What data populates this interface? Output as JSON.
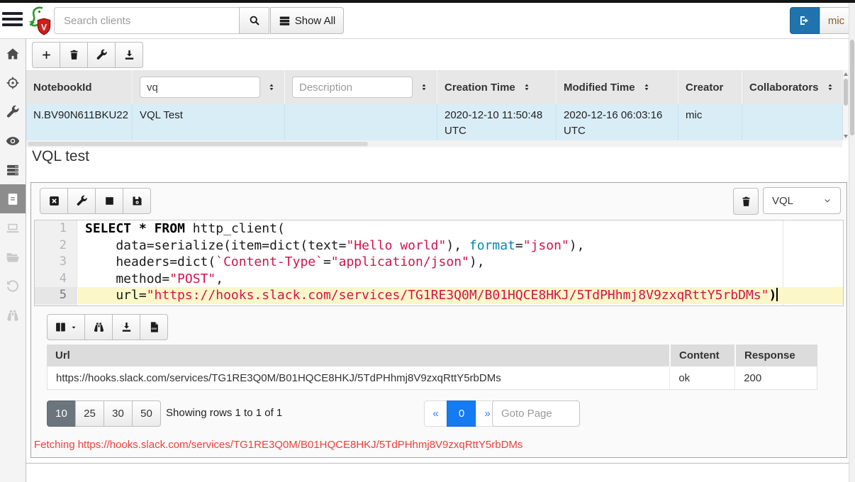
{
  "topbar": {
    "search_placeholder": "Search clients",
    "search_value": "",
    "show_all_label": "Show All",
    "user_label": "mic"
  },
  "colors": {
    "logout_blue": "#2074ae",
    "pager_active_blue": "#147bf0",
    "selected_row_blue": "#d9edf7",
    "active_line_yellow": "#fbf7c8",
    "code_string_red": "#d1154b",
    "code_builtin_blue": "#0086b3",
    "status_error_red": "#ee3f3b",
    "active_pagesize_gray": "#6c757d"
  },
  "sidebar": {
    "items": [
      {
        "icon": "home-icon",
        "state": "enabled"
      },
      {
        "icon": "crosshair-icon",
        "state": "enabled"
      },
      {
        "icon": "wrench-icon",
        "state": "enabled"
      },
      {
        "icon": "eye-icon",
        "state": "enabled"
      },
      {
        "icon": "server-icon",
        "state": "enabled"
      },
      {
        "icon": "notebook-icon",
        "state": "active"
      },
      {
        "icon": "laptop-icon",
        "state": "disabled"
      },
      {
        "icon": "folder-icon",
        "state": "disabled"
      },
      {
        "icon": "history-icon",
        "state": "disabled"
      },
      {
        "icon": "binoculars-icon",
        "state": "disabled"
      }
    ]
  },
  "notebooks": {
    "toolbar": [
      {
        "icon": "plus-icon"
      },
      {
        "icon": "trash-icon"
      },
      {
        "icon": "wrench-icon"
      },
      {
        "icon": "download-icon"
      }
    ],
    "table": {
      "columns": [
        {
          "label": "NotebookId"
        },
        {
          "value": "vq",
          "placeholder": ""
        },
        {
          "value": "",
          "placeholder": "Description"
        },
        {
          "label": "Creation Time"
        },
        {
          "label": "Modified Time"
        },
        {
          "label": "Creator"
        },
        {
          "label": "Collaborators"
        }
      ],
      "row": {
        "notebook_id": "N.BV90N611BKU22",
        "name": "VQL Test",
        "description": "",
        "creation_time": "2020-12-10 11:50:48 UTC",
        "modified_time": "2020-12-16 06:03:16 UTC",
        "creator": "mic",
        "collaborators": ""
      }
    }
  },
  "notebook": {
    "title": "VQL test",
    "cell_toolbar": [
      {
        "icon": "close-square-icon"
      },
      {
        "icon": "wrench-icon"
      },
      {
        "icon": "stop-icon"
      },
      {
        "icon": "save-icon"
      }
    ],
    "cell_type_selected": "VQL",
    "code_lines": [
      {
        "number": "1",
        "active": false,
        "tokens": [
          {
            "text": "SELECT",
            "type": "keyword"
          },
          {
            "text": " ",
            "type": "plain"
          },
          {
            "text": "*",
            "type": "keyword"
          },
          {
            "text": " ",
            "type": "plain"
          },
          {
            "text": "FROM",
            "type": "keyword"
          },
          {
            "text": " http_client(",
            "type": "plain"
          }
        ]
      },
      {
        "number": "2",
        "active": false,
        "tokens": [
          {
            "text": "    data=serialize(item=dict(text=",
            "type": "plain"
          },
          {
            "text": "\"Hello world\"",
            "type": "string"
          },
          {
            "text": "), ",
            "type": "plain"
          },
          {
            "text": "format",
            "type": "builtin"
          },
          {
            "text": "=",
            "type": "plain"
          },
          {
            "text": "\"json\"",
            "type": "string"
          },
          {
            "text": "),",
            "type": "plain"
          }
        ]
      },
      {
        "number": "3",
        "active": false,
        "tokens": [
          {
            "text": "    headers=dict(",
            "type": "plain"
          },
          {
            "text": "`Content-Type`",
            "type": "string"
          },
          {
            "text": "=",
            "type": "plain"
          },
          {
            "text": "\"application/json\"",
            "type": "string"
          },
          {
            "text": "),",
            "type": "plain"
          }
        ]
      },
      {
        "number": "4",
        "active": false,
        "tokens": [
          {
            "text": "    method=",
            "type": "plain"
          },
          {
            "text": "\"POST\"",
            "type": "string"
          },
          {
            "text": ",",
            "type": "plain"
          }
        ]
      },
      {
        "number": "5",
        "active": true,
        "tokens": [
          {
            "text": "    url=",
            "type": "plain"
          },
          {
            "text": "\"https://hooks.slack.com/services/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\"",
            "type": "string"
          },
          {
            "text": ")",
            "type": "keyword"
          }
        ]
      }
    ],
    "results_toolbar": [
      {
        "icon": "columns-icon"
      },
      {
        "icon": "binoculars-icon"
      },
      {
        "icon": "download-icon"
      },
      {
        "icon": "csv-icon"
      }
    ],
    "results_table": {
      "columns": [
        "Url",
        "Content",
        "Response"
      ],
      "rows": [
        [
          "https://hooks.slack.com/services/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",
          "ok",
          "200"
        ]
      ]
    },
    "pagination": {
      "page_sizes": [
        "10",
        "25",
        "30",
        "50"
      ],
      "active_page_size": "10",
      "summary": "Showing rows 1 to 1 of 1",
      "prev_label": "«",
      "current_page": "0",
      "next_label": "»",
      "goto_placeholder": "Goto Page"
    },
    "status_message": "Fetching https://hooks.slack.com/services/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"
  }
}
